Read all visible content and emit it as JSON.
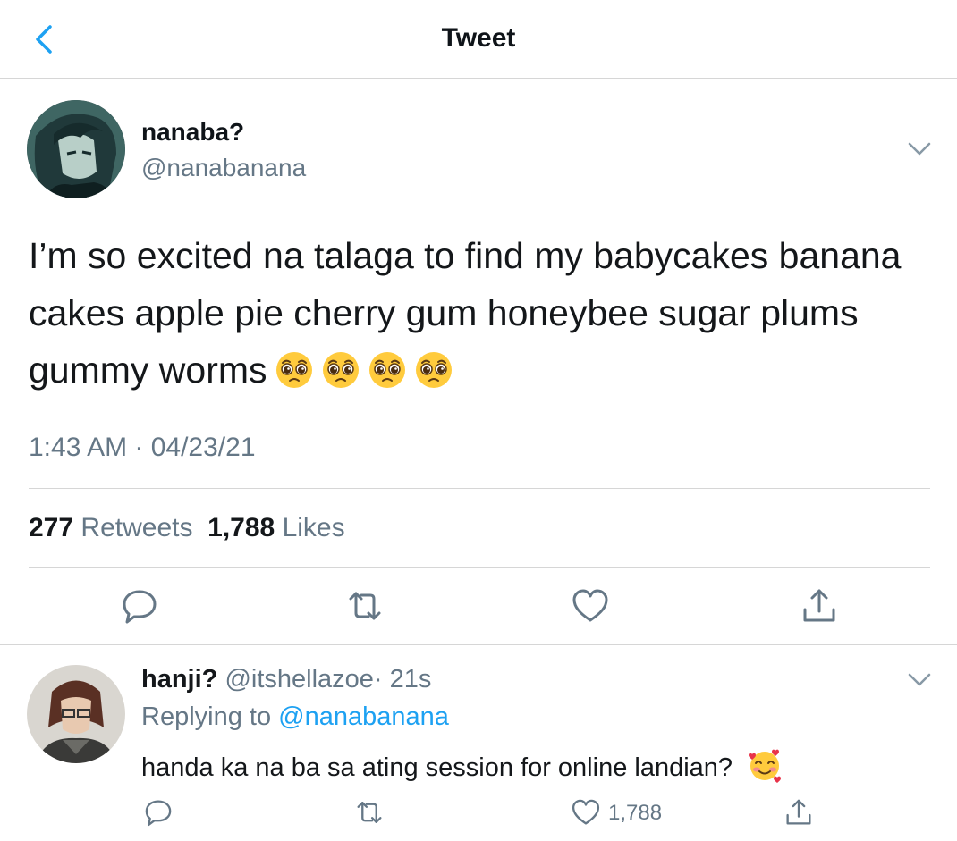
{
  "header": {
    "title": "Tweet",
    "back_icon": "chevron-left-icon"
  },
  "colors": {
    "accent": "#1da1f2",
    "muted": "#657786",
    "text": "#14171a",
    "divider": "#d6d6d6"
  },
  "tweet": {
    "author_name": "nanaba?",
    "author_handle": "@nanabanana",
    "text": "I’m so excited na talaga to find my babycakes banana cakes apple pie cherry gum honeybee sugar plums gummy worms",
    "emoji": "pleading-face",
    "emoji_count": 4,
    "timestamp": "1:43 AM · 04/23/21",
    "retweets_count": "277",
    "retweets_label": "Retweets",
    "likes_count": "1,788",
    "likes_label": "Likes"
  },
  "reply": {
    "author_name": "hanji?",
    "author_handle": "@itshellazoe",
    "time": "· 21s",
    "replying_to_label": "Replying to",
    "replying_to_handle": "@nanabanana",
    "text": "handa ka na ba sa ating session for online landian?",
    "emoji": "smiling-face-with-hearts",
    "like_count": "1,788"
  }
}
